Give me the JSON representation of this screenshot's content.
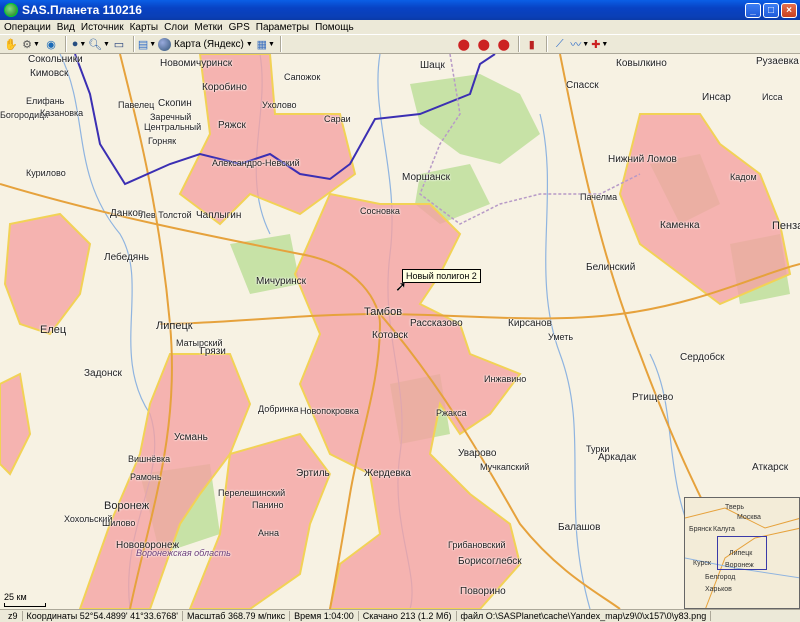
{
  "window": {
    "title": "SAS.Планета 110216",
    "min_label": "_",
    "max_label": "□",
    "close_label": "×"
  },
  "menu": [
    "Операции",
    "Вид",
    "Источник",
    "Карты",
    "Слои",
    "Метки",
    "GPS",
    "Параметры",
    "Помощь"
  ],
  "toolbar": {
    "map_source": "Карта (Яндекс)"
  },
  "map": {
    "tooltip": "Новый полигон 2",
    "scale_label": "25 км",
    "labels": [
      {
        "t": "Сокольники"
      },
      {
        "t": "Кимовск"
      },
      {
        "t": "Новомичуринск"
      },
      {
        "t": "Шацк"
      },
      {
        "t": "Ковылкино"
      },
      {
        "t": "Рузаевка"
      },
      {
        "t": "Коробино"
      },
      {
        "t": "Сапожок"
      },
      {
        "t": "Елифань"
      },
      {
        "t": "Павелец"
      },
      {
        "t": "Скопин"
      },
      {
        "t": "Ухолово"
      },
      {
        "t": "Сараи"
      },
      {
        "t": "Спасск"
      },
      {
        "t": "Инсар"
      },
      {
        "t": "Исса"
      },
      {
        "t": "Богородицк"
      },
      {
        "t": "Заречный"
      },
      {
        "t": "Ряжск"
      },
      {
        "t": "Казановка"
      },
      {
        "t": "Центральный"
      },
      {
        "t": "Горняк"
      },
      {
        "t": "Александро-Невский"
      },
      {
        "t": "Моршанск"
      },
      {
        "t": "Нижний Ломов"
      },
      {
        "t": "Кадом"
      },
      {
        "t": "Курилово"
      },
      {
        "t": "Данков"
      },
      {
        "t": "Лев Толстой"
      },
      {
        "t": "Чаплыгин"
      },
      {
        "t": "Сосновка"
      },
      {
        "t": "Пачелма"
      },
      {
        "t": "Каменка"
      },
      {
        "t": "Пенза"
      },
      {
        "t": "Лебедянь"
      },
      {
        "t": "Мичуринск"
      },
      {
        "t": "Белинский"
      },
      {
        "t": "Елец"
      },
      {
        "t": "Липецк"
      },
      {
        "t": "Тамбов"
      },
      {
        "t": "Рассказово"
      },
      {
        "t": "Кирсанов"
      },
      {
        "t": "Котовск"
      },
      {
        "t": "Уметь"
      },
      {
        "t": "Матырский"
      },
      {
        "t": "Грязи"
      },
      {
        "t": "Задонск"
      },
      {
        "t": "Сердобск"
      },
      {
        "t": "Инжавино"
      },
      {
        "t": "Ртищево"
      },
      {
        "t": "Добринка"
      },
      {
        "t": "Новопокровка"
      },
      {
        "t": "Жердевка"
      },
      {
        "t": "Ржакса"
      },
      {
        "t": "Усмань"
      },
      {
        "t": "Турки"
      },
      {
        "t": "Аркадак"
      },
      {
        "t": "Аткарск"
      },
      {
        "t": "Эртиль"
      },
      {
        "t": "Уварово"
      },
      {
        "t": "Мучкапский"
      },
      {
        "t": "Воронеж"
      },
      {
        "t": "Хохольский"
      },
      {
        "t": "Перелешинский"
      },
      {
        "t": "Панино"
      },
      {
        "t": "Балашов"
      },
      {
        "t": "Грибановский"
      },
      {
        "t": "Нововоронеж"
      },
      {
        "t": "Борисоглебск"
      },
      {
        "t": "Поворино"
      },
      {
        "t": "Воронежская область"
      },
      {
        "t": "Рамонь"
      },
      {
        "t": "Анна"
      },
      {
        "t": "Шилово"
      },
      {
        "t": "Вишнёвка"
      }
    ],
    "minimap": [
      "Москва",
      "Брянск",
      "Калуга",
      "Липецк",
      "Курск",
      "Воронеж",
      "Белгород",
      "Харьков",
      "Тверь"
    ]
  },
  "status": {
    "zoom": "z9",
    "coords": "Координаты 52°54.4899' 41°33.6768'",
    "scale": "Масштаб 368.79 м/пикс",
    "time": "Время 1:04:00",
    "downloaded": "Скачано 213 (1.2 Мб)",
    "file": "файл O:\\SASPlanet\\cache\\Yandex_map\\z9\\0\\x157\\0\\y83.png"
  },
  "colors": {
    "title_bar": "#0842c4",
    "polygon_fill": "#f4a3a3",
    "polygon_stroke": "#f2d256",
    "border_line": "#3b2fb3",
    "forest": "#c7e2a6"
  }
}
